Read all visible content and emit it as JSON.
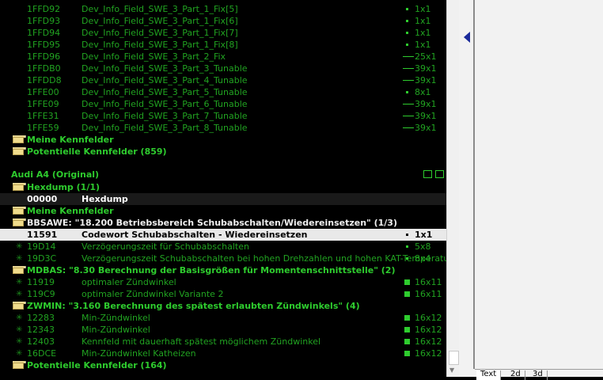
{
  "top_rows": [
    {
      "addr": "1FFD92",
      "name": "Dev_Info_Field_SWE_3_Part_1_Fix[5]",
      "size": "1x1",
      "kind": "dot"
    },
    {
      "addr": "1FFD93",
      "name": "Dev_Info_Field_SWE_3_Part_1_Fix[6]",
      "size": "1x1",
      "kind": "dot"
    },
    {
      "addr": "1FFD94",
      "name": "Dev_Info_Field_SWE_3_Part_1_Fix[7]",
      "size": "1x1",
      "kind": "dot"
    },
    {
      "addr": "1FFD95",
      "name": "Dev_Info_Field_SWE_3_Part_1_Fix[8]",
      "size": "1x1",
      "kind": "dot"
    },
    {
      "addr": "1FFD96",
      "name": "Dev_Info_Field_SWE_3_Part_2_Fix",
      "size": "25x1",
      "kind": "bar"
    },
    {
      "addr": "1FFDB0",
      "name": "Dev_Info_Field_SWE_3_Part_3_Tunable",
      "size": "39x1",
      "kind": "bar"
    },
    {
      "addr": "1FFDD8",
      "name": "Dev_Info_Field_SWE_3_Part_4_Tunable",
      "size": "39x1",
      "kind": "bar"
    },
    {
      "addr": "1FFE00",
      "name": "Dev_Info_Field_SWE_3_Part_5_Tunable",
      "size": "8x1",
      "kind": "dot"
    },
    {
      "addr": "1FFE09",
      "name": "Dev_Info_Field_SWE_3_Part_6_Tunable",
      "size": "39x1",
      "kind": "bar"
    },
    {
      "addr": "1FFE31",
      "name": "Dev_Info_Field_SWE_3_Part_7_Tunable",
      "size": "39x1",
      "kind": "bar"
    },
    {
      "addr": "1FFE59",
      "name": "Dev_Info_Field_SWE_3_Part_8_Tunable",
      "size": "39x1",
      "kind": "bar"
    }
  ],
  "folder_meine_1": "Meine Kennfelder",
  "folder_potentielle_1": "Potentielle Kennfelder (859)",
  "project_title": "Audi A4 (Original)",
  "hexdump_folder": "Hexdump (1/1)",
  "hexdump_row": {
    "addr": "00000",
    "name": "Hexdump"
  },
  "folder_meine_2": "Meine Kennfelder",
  "bbsawe_folder": "BBSAWE: \"18.200 Betriebsbereich Schubabschalten/Wiedereinsetzen\" (1/3)",
  "bbsawe_rows": [
    {
      "addr": "11591",
      "name": "Codewort Schubabschalten - Wiedereinsetzen",
      "size": "1x1",
      "selected": true
    },
    {
      "addr": "19D14",
      "name": "Verzögerungszeit für Schubabschalten",
      "size": "5x8"
    },
    {
      "addr": "19D3C",
      "name": "Verzögerungszeit Schubabschalten bei hohen Drehzahlen und hohen KAT-Temperatu",
      "size": "8x4"
    }
  ],
  "mdbas_folder": "MDBAS: \"8.30 Berechnung der Basisgrößen für Momentenschnittstelle\" (2)",
  "mdbas_rows": [
    {
      "addr": "11919",
      "name": "optimaler Zündwinkel",
      "size": "16x11"
    },
    {
      "addr": "119C9",
      "name": "optimaler Zündwinkel Variante 2",
      "size": "16x11"
    }
  ],
  "zwmin_folder": "ZWMIN: \"3.160 Berechnung des spätest erlaubten Zündwinkels\" (4)",
  "zwmin_rows": [
    {
      "addr": "12283",
      "name": "Min-Zündwinkel",
      "size": "16x12"
    },
    {
      "addr": "12343",
      "name": "Min-Zündwinkel",
      "size": "16x12"
    },
    {
      "addr": "12403",
      "name": "Kennfeld mit dauerhaft spätest möglichem Zündwinkel",
      "size": "16x12"
    },
    {
      "addr": "16DCE",
      "name": "Min-Zündwinkel Katheizen",
      "size": "16x12"
    }
  ],
  "folder_potentielle_2": "Potentielle Kennfelder (164)",
  "tabs": [
    "Text",
    "2d",
    "3d"
  ],
  "colors": {
    "green": "#21a321",
    "bright_green": "#2ecc2e",
    "background": "#000000"
  }
}
